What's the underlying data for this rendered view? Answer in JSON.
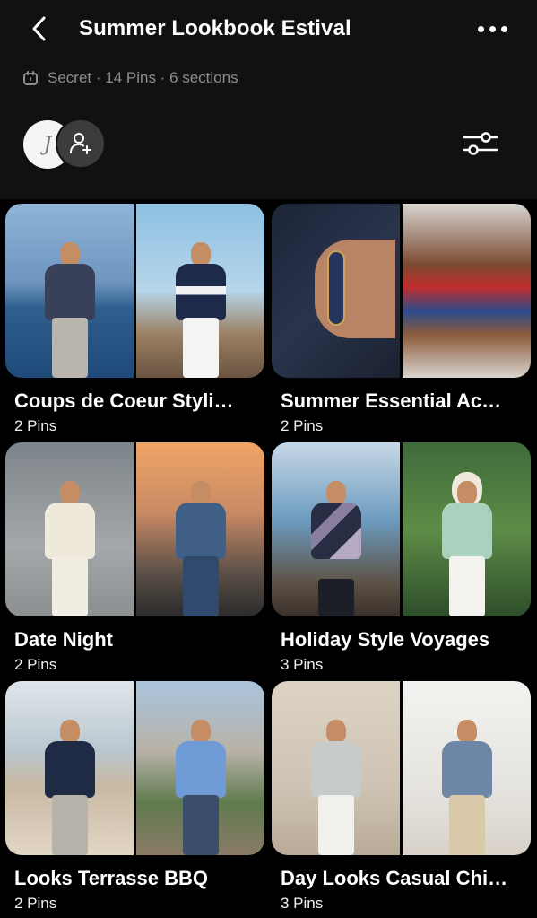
{
  "header": {
    "title": "Summer Lookbook Estival",
    "meta": "Secret · 14 Pins · 6 sections",
    "avatar_initial": "J"
  },
  "boards": [
    {
      "title": "Coups de Coeur Styli…",
      "count": "2 Pins"
    },
    {
      "title": "Summer Essential Ac…",
      "count": "2 Pins"
    },
    {
      "title": "Date Night",
      "count": "2 Pins"
    },
    {
      "title": "Holiday Style Voyages",
      "count": "3 Pins"
    },
    {
      "title": "Looks Terrasse BBQ",
      "count": "2 Pins"
    },
    {
      "title": "Day Looks Casual Chi…",
      "count": "3 Pins"
    }
  ],
  "colors": {
    "background": "#000000",
    "header_bg": "#111111",
    "muted_text": "#8e8e8e",
    "add_button_bg": "#3c3c3c"
  }
}
